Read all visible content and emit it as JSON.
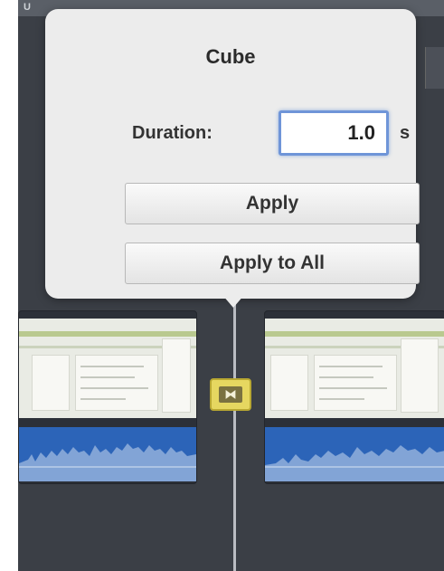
{
  "toolbar": {
    "label": "U"
  },
  "popover": {
    "title": "Cube",
    "duration_label": "Duration:",
    "duration_value": "1.0",
    "duration_unit": "s",
    "apply_label": "Apply",
    "apply_all_label": "Apply to All"
  },
  "timeline": {
    "transition_glyph": "⧓"
  },
  "colors": {
    "audio_waveform": "#2c64b8",
    "transition_badge": "#e6d760",
    "input_focus": "#6f95d8"
  }
}
